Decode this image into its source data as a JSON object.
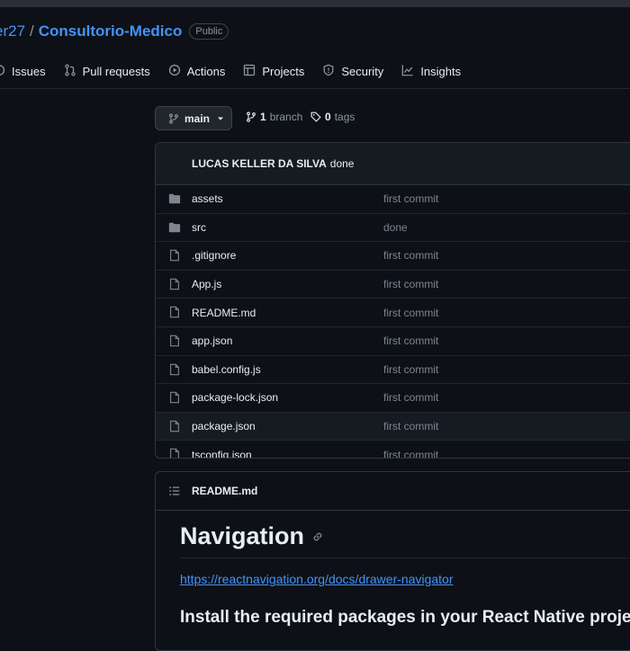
{
  "repo": {
    "owner": "er27",
    "separator": "/",
    "name": "Consultorio-Medico",
    "visibility": "Public"
  },
  "tabs": [
    {
      "label": "Issues",
      "icon": "issue-icon"
    },
    {
      "label": "Pull requests",
      "icon": "pull-request-icon"
    },
    {
      "label": "Actions",
      "icon": "play-icon"
    },
    {
      "label": "Projects",
      "icon": "table-icon"
    },
    {
      "label": "Security",
      "icon": "shield-icon"
    },
    {
      "label": "Insights",
      "icon": "graph-icon"
    }
  ],
  "branch": {
    "current": "main",
    "branch_count": "1",
    "branch_label": "branch",
    "tag_count": "0",
    "tag_label": "tags"
  },
  "latest_commit": {
    "author": "LUCAS KELLER DA SILVA",
    "message": "done"
  },
  "files": [
    {
      "name": "assets",
      "type": "dir",
      "message": "first commit"
    },
    {
      "name": "src",
      "type": "dir",
      "message": "done"
    },
    {
      "name": ".gitignore",
      "type": "file",
      "message": "first commit"
    },
    {
      "name": "App.js",
      "type": "file",
      "message": "first commit"
    },
    {
      "name": "README.md",
      "type": "file",
      "message": "first commit"
    },
    {
      "name": "app.json",
      "type": "file",
      "message": "first commit"
    },
    {
      "name": "babel.config.js",
      "type": "file",
      "message": "first commit"
    },
    {
      "name": "package-lock.json",
      "type": "file",
      "message": "first commit"
    },
    {
      "name": "package.json",
      "type": "file",
      "message": "first commit"
    },
    {
      "name": "tsconfig.json",
      "type": "file",
      "message": "first commit"
    }
  ],
  "readme": {
    "filename": "README.md",
    "heading": "Navigation",
    "link": "https://reactnavigation.org/docs/drawer-navigator",
    "subheading": "Install the required packages in your React Native proje"
  },
  "colors": {
    "background": "#0d1117",
    "link": "#4493f8",
    "muted": "#7d8590",
    "border": "#30363d"
  }
}
